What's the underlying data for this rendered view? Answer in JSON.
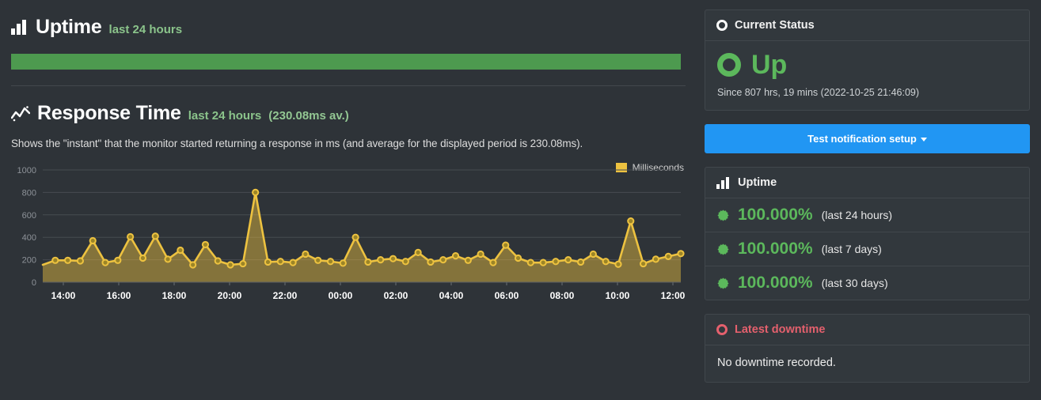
{
  "uptime_section": {
    "icon": "bar-chart-icon",
    "title": "Uptime",
    "subtitle": "last 24 hours",
    "bar_color": "#4d9a4f",
    "bar_percent": "100"
  },
  "response_section": {
    "icon": "line-chart-icon",
    "title": "Response Time",
    "subtitle": "last 24 hours",
    "average_label": "(230.08ms av.)",
    "description": "Shows the \"instant\" that the monitor started returning a response in ms (and average for the displayed period is 230.08ms)."
  },
  "chart_data": {
    "type": "area",
    "title": "Response Time",
    "xlabel": "",
    "ylabel": "Milliseconds",
    "ylim": [
      0,
      1000
    ],
    "yticks": [
      0,
      200,
      400,
      600,
      800,
      1000
    ],
    "xticks": [
      "14:00",
      "16:00",
      "18:00",
      "20:00",
      "22:00",
      "00:00",
      "02:00",
      "04:00",
      "06:00",
      "08:00",
      "10:00",
      "12:00"
    ],
    "grid": true,
    "legend_position": "top-right",
    "legend": [
      "Milliseconds"
    ],
    "series_color": "#edc240",
    "fill_color": "rgba(237,194,64,0.45)",
    "series": [
      {
        "name": "Milliseconds",
        "x": [
          "13:00",
          "13:30",
          "14:00",
          "14:30",
          "15:00",
          "15:30",
          "16:00",
          "16:30",
          "17:00",
          "17:30",
          "18:00",
          "18:30",
          "19:00",
          "19:30",
          "20:00",
          "20:30",
          "21:00",
          "21:30",
          "22:00",
          "22:30",
          "23:00",
          "23:30",
          "00:00",
          "00:30",
          "01:00",
          "01:30",
          "02:00",
          "02:30",
          "03:00",
          "03:30",
          "04:00",
          "04:30",
          "05:00",
          "05:30",
          "06:00",
          "06:30",
          "07:00",
          "07:30",
          "08:00",
          "08:30",
          "09:00",
          "09:30",
          "10:00",
          "10:30",
          "11:00",
          "11:30",
          "12:00",
          "12:30",
          "13:00"
        ],
        "values": [
          155,
          195,
          195,
          190,
          370,
          175,
          195,
          405,
          215,
          410,
          205,
          285,
          155,
          335,
          190,
          155,
          165,
          800,
          180,
          185,
          175,
          250,
          195,
          185,
          170,
          400,
          180,
          200,
          210,
          185,
          265,
          180,
          200,
          235,
          195,
          250,
          175,
          330,
          215,
          175,
          175,
          185,
          200,
          180,
          250,
          185,
          160,
          545,
          165,
          205,
          230,
          255
        ]
      }
    ]
  },
  "current_status": {
    "header_icon": "circle-dot-icon",
    "header_title": "Current Status",
    "status_icon": "circle-dot-icon",
    "status_text": "Up",
    "status_color": "#5cb85c",
    "since_text": "Since 807 hrs, 19 mins (2022-10-25 21:46:09)"
  },
  "test_button": {
    "label": "Test notification setup",
    "caret_icon": "chevron-down-icon",
    "color": "#2196f3"
  },
  "uptime_panel": {
    "header_icon": "bar-chart-icon",
    "header_title": "Uptime",
    "rows": [
      {
        "icon": "starburst-icon",
        "percent": "100.000%",
        "period": "(last 24 hours)"
      },
      {
        "icon": "starburst-icon",
        "percent": "100.000%",
        "period": "(last 7 days)"
      },
      {
        "icon": "starburst-icon",
        "percent": "100.000%",
        "period": "(last 30 days)"
      }
    ]
  },
  "latest_downtime": {
    "header_icon": "circle-dot-icon",
    "header_title": "Latest downtime",
    "header_color": "#e4606d",
    "body_text": "No downtime recorded."
  }
}
